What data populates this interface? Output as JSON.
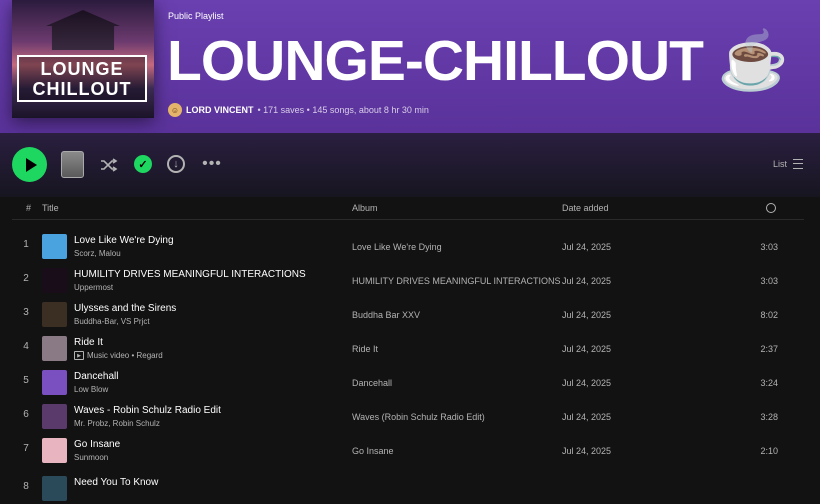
{
  "playlist": {
    "type_label": "Public Playlist",
    "title": "LOUNGE-CHILLOUT ☕",
    "cover_line1": "LOUNGE",
    "cover_line2": "CHILLOUT",
    "owner": "LORD VINCENT",
    "stats": "• 171 saves • 145 songs, about 8 hr 30 min"
  },
  "actions": {
    "list_label": "List"
  },
  "icons": {
    "play": "play-icon",
    "shuffle": "shuffle-icon",
    "saved": "check-icon",
    "download": "download-icon",
    "more": "more-icon",
    "list": "list-icon",
    "clock": "clock-icon"
  },
  "colors": {
    "accent": "#1ed760",
    "header_bg": "#5a329a",
    "page_bg": "#121212"
  },
  "table": {
    "headers": {
      "num": "#",
      "title": "Title",
      "album": "Album",
      "date": "Date added"
    },
    "rows": [
      {
        "num": "1",
        "title": "Love Like We're Dying",
        "artist": "Scorz, Malou",
        "album": "Love Like We're Dying",
        "date": "Jul 24, 2025",
        "duration": "3:03",
        "thumb": "#4aa3df",
        "music_video": false
      },
      {
        "num": "2",
        "title": "HUMILITY DRIVES MEANINGFUL INTERACTIONS",
        "artist": "Uppermost",
        "album": "HUMILITY DRIVES MEANINGFUL INTERACTIONS",
        "date": "Jul 24, 2025",
        "duration": "3:03",
        "thumb": "#1a0d1a",
        "music_video": false
      },
      {
        "num": "3",
        "title": "Ulysses and the Sirens",
        "artist": "Buddha-Bar, VS Prjct",
        "album": "Buddha Bar XXV",
        "date": "Jul 24, 2025",
        "duration": "8:02",
        "thumb": "#3a2f22",
        "music_video": false
      },
      {
        "num": "4",
        "title": "Ride It",
        "artist": "Music video • Regard",
        "album": "Ride It",
        "date": "Jul 24, 2025",
        "duration": "2:37",
        "thumb": "#8a7a86",
        "music_video": true
      },
      {
        "num": "5",
        "title": "Dancehall",
        "artist": "Low Blow",
        "album": "Dancehall",
        "date": "Jul 24, 2025",
        "duration": "3:24",
        "thumb": "#7a4fc0",
        "music_video": false
      },
      {
        "num": "6",
        "title": "Waves - Robin Schulz Radio Edit",
        "artist": "Mr. Probz, Robin Schulz",
        "album": "Waves (Robin Schulz Radio Edit)",
        "date": "Jul 24, 2025",
        "duration": "3:28",
        "thumb": "#5a3a6a",
        "music_video": false
      },
      {
        "num": "7",
        "title": "Go Insane",
        "artist": "Sunmoon",
        "album": "Go Insane",
        "date": "Jul 24, 2025",
        "duration": "2:10",
        "thumb": "#e8b4c0",
        "music_video": false
      },
      {
        "num": "8",
        "title": "Need You To Know",
        "artist": "",
        "album": "",
        "date": "",
        "duration": "",
        "thumb": "#2a4a5a",
        "music_video": false
      }
    ]
  }
}
